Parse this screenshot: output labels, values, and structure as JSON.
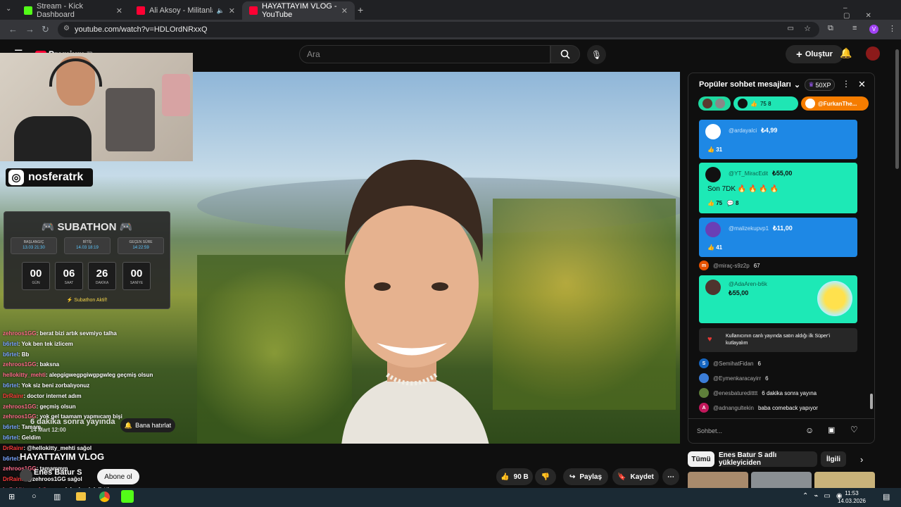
{
  "browser": {
    "tabs": [
      {
        "title": "Stream - Kick Dashboard",
        "color": "#53fc18"
      },
      {
        "title": "Ali Aksoy - Militanlar - YouTube",
        "color": "#ff0033"
      },
      {
        "title": "HAYATTAYIM VLOG - YouTube",
        "color": "#ff0033"
      }
    ],
    "url": "youtube.com/watch?v=HDLOrdNRxxQ"
  },
  "youtube": {
    "search_placeholder": "Ara",
    "create_label": "Oluştur",
    "logo_text": "Premium",
    "region": "TR"
  },
  "overlay": {
    "instagram_handle": "nosferatrk",
    "subathon": {
      "title": "SUBATHON",
      "boxes": [
        {
          "label": "BAŞLANGIÇ",
          "value": "13.03 21:30"
        },
        {
          "label": "BİTİŞ",
          "value": "14.03 18:19"
        },
        {
          "label": "GEÇEN SÜRE",
          "value": "14:22:59"
        }
      ],
      "counters": [
        {
          "num": "00",
          "unit": "GÜN"
        },
        {
          "num": "06",
          "unit": "SAAT"
        },
        {
          "num": "26",
          "unit": "DAKİKA"
        },
        {
          "num": "00",
          "unit": "SANİYE"
        }
      ],
      "status": "⚡ Subathon Aktif!"
    },
    "chat": [
      {
        "name": "zehroos1GG",
        "text": "berat bizi artık sevmiyo talha",
        "c": "p"
      },
      {
        "name": "b6rtel",
        "text": "Yok ben tek izlicem",
        "c": "b"
      },
      {
        "name": "b6rtel",
        "text": "Bb",
        "c": "b"
      },
      {
        "name": "zehroos1GG",
        "text": "baksna",
        "c": "p"
      },
      {
        "name": "hellokitty_mehti",
        "text": "alepgigwegpgiwgpgwleg geçmiş olsun",
        "c": "p"
      },
      {
        "name": "b6rtel",
        "text": "Yok siz beni zorbalıyonuz",
        "c": "b"
      },
      {
        "name": "DrRainr",
        "text": "doctor internet adım",
        "c": "r"
      },
      {
        "name": "zehroos1GG",
        "text": "geçmiş olsun",
        "c": "p"
      },
      {
        "name": "zehroos1GG",
        "text": "yok gel taamam yapmıcam bişi",
        "c": "p"
      },
      {
        "name": "b6rtel",
        "text": "Tamam",
        "c": "b"
      },
      {
        "name": "b6rtel",
        "text": "Geldim",
        "c": "b"
      },
      {
        "name": "DrRainr",
        "text": "@hellokitty_mehti sağol",
        "c": "r"
      },
      {
        "name": "b6rtel",
        "text": "",
        "c": "b"
      },
      {
        "name": "zehroos1GG",
        "text": "tamammm",
        "c": "p"
      },
      {
        "name": "DrRainr",
        "text": "@zehroos1GG sağol",
        "c": "r"
      },
      {
        "name": "hellokitty_mehti",
        "text": "ya şarkılar beni delirtti",
        "c": "p"
      },
      {
        "name": "DrRainr",
        "text": "sağol",
        "c": "r"
      }
    ]
  },
  "premiere": {
    "text": "6 dakika sonra yayında",
    "date": "14 Mart 12:00",
    "remind_label": "Bana hatırlat"
  },
  "video": {
    "title": "HAYATTAYIM VLOG",
    "channel": "Enes Batur S",
    "subscribe_label": "Abone ol",
    "likes": "90 B",
    "share_label": "Paylaş",
    "save_label": "Kaydet"
  },
  "live_chat": {
    "header": "Popüler sohbet mesajları",
    "xp": "50XP",
    "pills": [
      {
        "text": "",
        "bg": "#1fd9a0"
      },
      {
        "text": "75  8",
        "bg": "#1fe6b4"
      },
      {
        "text": "@FurkanThe...",
        "bg": "#f57c00"
      }
    ],
    "superchats": [
      {
        "name": "@ardayalci",
        "amount": "₺4,99",
        "likes": "31",
        "bg": "#1e88e5",
        "av": "#ffffff"
      },
      {
        "name": "@YT_MiracEdit",
        "amount": "₺55,00",
        "msg": "Son 7DK 🔥 🔥 🔥 🔥",
        "likes": "75",
        "replies": "8",
        "bg": "#1de9b6",
        "av": "#111111"
      },
      {
        "name": "@malizekupvp1",
        "amount": "₺11,00",
        "likes": "41",
        "bg": "#1e88e5",
        "av": "#6a3fb5"
      },
      {
        "name": "@AdaAren-b6k",
        "amount": "₺55,00",
        "bg": "#1de9b6",
        "av": "#4e342e"
      }
    ],
    "messages_top": [
      {
        "name": "@miraç-s9z2p",
        "text": "67",
        "av": "#e65100",
        "letter": "m"
      }
    ],
    "system_msg": "Kullanıcının canlı yayında satın aldığı ilk Süper'i kutlayalım",
    "messages": [
      {
        "name": "@SemihatFidan",
        "text": "6",
        "av": "#1565c0",
        "letter": "S"
      },
      {
        "name": "@Eymenkaracayirr",
        "text": "6",
        "av": "#3b7dd8",
        "letter": ""
      },
      {
        "name": "@enesbatureditttt",
        "text": "6 dakika sonra yayına",
        "av": "#5e7f3a",
        "letter": ""
      },
      {
        "name": "@adnangultekin",
        "text": "baba comeback yapıyor",
        "av": "#c2185b",
        "letter": "A"
      }
    ],
    "input_placeholder": "Sohbet..."
  },
  "filters": [
    "Tümü",
    "Enes Batur S adlı yükleyiciden",
    "İlgili"
  ],
  "taskbar": {
    "time": "11:53",
    "date": "14.03.2026"
  }
}
